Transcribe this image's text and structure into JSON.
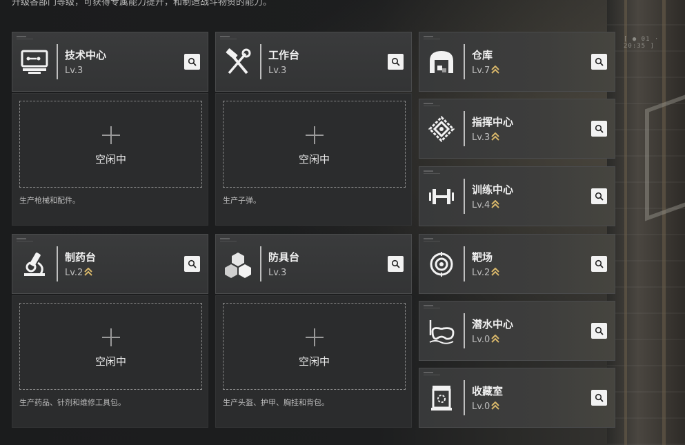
{
  "intro_text": "升级各部门等级，可获得专属能力提升，和制造战斗物资的能力。",
  "hud_readout": "[ ● 01 · 20:35 ]",
  "accent_color": "#d9b86a",
  "idle_label": "空闲中",
  "facilities": [
    {
      "name": "技术中心",
      "level": "Lv.3",
      "icon": "tech-center-icon",
      "upgradable": false,
      "slot_desc": "生产枪械和配件。"
    },
    {
      "name": "工作台",
      "level": "Lv.3",
      "icon": "hammer-wrench-icon",
      "upgradable": false,
      "slot_desc": "生产子弹。"
    },
    {
      "name": "仓库",
      "level": "Lv.7",
      "icon": "warehouse-icon",
      "upgradable": true
    },
    {
      "name": "指挥中心",
      "level": "Lv.3",
      "icon": "command-center-icon",
      "upgradable": true
    },
    {
      "name": "训练中心",
      "level": "Lv.4",
      "icon": "dumbbell-icon",
      "upgradable": true
    },
    {
      "name": "制药台",
      "level": "Lv.2",
      "icon": "microscope-icon",
      "upgradable": true,
      "slot_desc": "生产药品、针剂和维修工具包。"
    },
    {
      "name": "防具台",
      "level": "Lv.3",
      "icon": "armor-cubes-icon",
      "upgradable": false,
      "slot_desc": "生产头盔、护甲、胸挂和背包。"
    },
    {
      "name": "靶场",
      "level": "Lv.2",
      "icon": "target-icon",
      "upgradable": true
    },
    {
      "name": "潜水中心",
      "level": "Lv.0",
      "icon": "diving-mask-icon",
      "upgradable": true
    },
    {
      "name": "收藏室",
      "level": "Lv.0",
      "icon": "collection-room-icon",
      "upgradable": true
    }
  ]
}
